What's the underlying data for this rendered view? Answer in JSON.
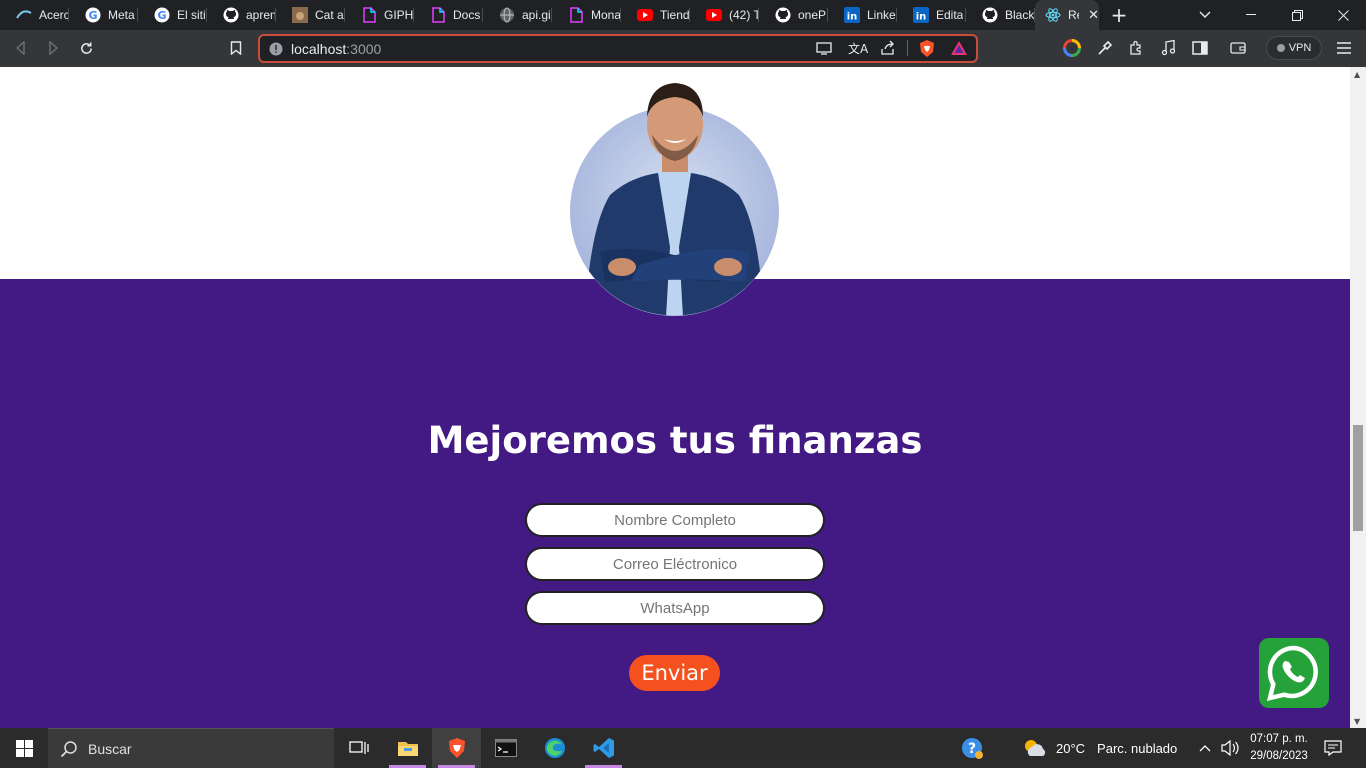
{
  "browser": {
    "tabs": [
      {
        "title": "Acerc",
        "icon": "acer-icon"
      },
      {
        "title": "Meta",
        "icon": "google-icon"
      },
      {
        "title": "El siti",
        "icon": "google-icon"
      },
      {
        "title": "apren",
        "icon": "github-icon"
      },
      {
        "title": "Cat a",
        "icon": "cat-icon"
      },
      {
        "title": "GIPH",
        "icon": "doc-icon"
      },
      {
        "title": "Docs",
        "icon": "doc-icon"
      },
      {
        "title": "api.gi",
        "icon": "globe-icon"
      },
      {
        "title": "Mona",
        "icon": "doc-icon"
      },
      {
        "title": "Tiend",
        "icon": "youtube-icon"
      },
      {
        "title": "(42) T",
        "icon": "youtube-icon"
      },
      {
        "title": "oneP",
        "icon": "github-icon"
      },
      {
        "title": "Linke",
        "icon": "linkedin-icon"
      },
      {
        "title": "Edita",
        "icon": "linkedin-icon"
      },
      {
        "title": "Black",
        "icon": "github-icon"
      }
    ],
    "active_tab": {
      "title": "Re",
      "icon": "react-icon"
    },
    "url_host": "localhost",
    "url_port": ":3000",
    "vpn_label": "VPN"
  },
  "page": {
    "headline": "Mejoremos tus finanzas",
    "form": {
      "name_placeholder": "Nombre Completo",
      "email_placeholder": "Correo Eléctronico",
      "whatsapp_placeholder": "WhatsApp",
      "submit_label": "Enviar"
    },
    "colors": {
      "band": "#431984",
      "button": "#f4511e",
      "whatsapp": "#25a33a"
    }
  },
  "taskbar": {
    "search_label": "Buscar",
    "weather_temp": "20°C",
    "weather_desc": "Parc. nublado",
    "time": "07:07 p. m.",
    "date": "29/08/2023"
  }
}
